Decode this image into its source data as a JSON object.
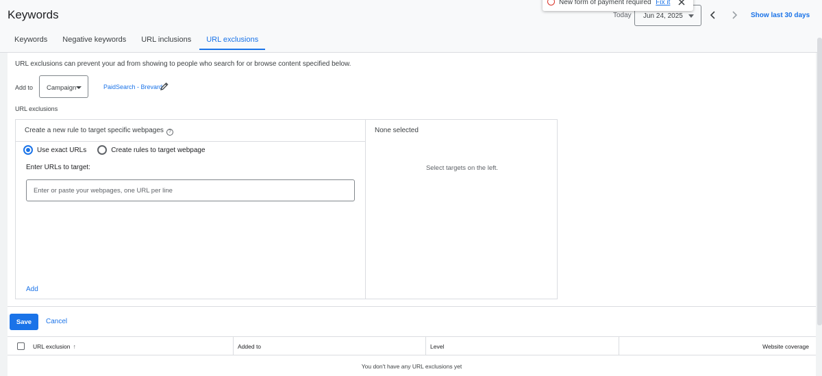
{
  "header": {
    "title": "Keywords",
    "tabs": [
      {
        "label": "Keywords",
        "active": false
      },
      {
        "label": "Negative keywords",
        "active": false
      },
      {
        "label": "URL inclusions",
        "active": false
      },
      {
        "label": "URL exclusions",
        "active": true
      }
    ],
    "today_label": "Today",
    "date": "Jun 24, 2025",
    "show_last_label": "Show last 30 days"
  },
  "notification": {
    "message": "New form of payment required",
    "action": "Fix it"
  },
  "main": {
    "intro": "URL exclusions can prevent your ad from showing to people who search for or browse content specified below.",
    "add_to_label": "Add to",
    "level_selected": "Campaign",
    "campaign_name": "PaidSearch - Brevard",
    "section_label": "URL exclusions"
  },
  "rule_panel": {
    "left_header": "Create a new rule to target specific webpages",
    "help_icon": "?",
    "radio_options": [
      {
        "label": "Use exact URLs",
        "selected": true
      },
      {
        "label": "Create rules to target webpage",
        "selected": false
      }
    ],
    "enter_label": "Enter URLs to target:",
    "input_value": "",
    "input_placeholder": "Enter or paste your webpages, one URL per line",
    "add_label": "Add",
    "right_header": "None selected",
    "right_empty": "Select targets on the left."
  },
  "actions": {
    "save_label": "Save",
    "cancel_label": "Cancel"
  },
  "table": {
    "columns": [
      "URL exclusion",
      "Added to",
      "Level",
      "Website coverage"
    ],
    "sort_indicator": "↑",
    "empty_message": "You don't have any URL exclusions yet"
  },
  "colors": {
    "accent": "#1a73e8",
    "error": "#d93025"
  }
}
